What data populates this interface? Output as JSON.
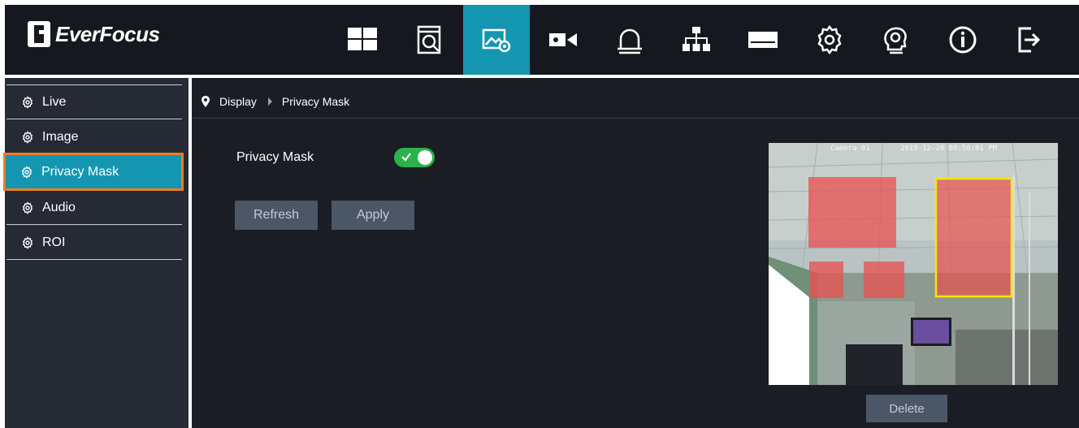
{
  "brand": {
    "name": "EverFocus"
  },
  "nav": [
    {
      "icon": "grid-icon",
      "active": false
    },
    {
      "icon": "playback-icon",
      "active": false
    },
    {
      "icon": "image-settings-icon",
      "active": true
    },
    {
      "icon": "camera-icon",
      "active": false
    },
    {
      "icon": "alarm-icon",
      "active": false
    },
    {
      "icon": "network-icon",
      "active": false
    },
    {
      "icon": "storage-icon",
      "active": false
    },
    {
      "icon": "settings-icon",
      "active": false
    },
    {
      "icon": "maintenance-icon",
      "active": false
    },
    {
      "icon": "info-icon",
      "active": false
    },
    {
      "icon": "logout-icon",
      "active": false
    }
  ],
  "sidebar": {
    "items": [
      {
        "label": "Live",
        "active": false
      },
      {
        "label": "Image",
        "active": false
      },
      {
        "label": "Privacy Mask",
        "active": true
      },
      {
        "label": "Audio",
        "active": false
      },
      {
        "label": "ROI",
        "active": false
      }
    ]
  },
  "breadcrumb": {
    "parent": "Display",
    "current": "Privacy Mask"
  },
  "form": {
    "privacy_mask_label": "Privacy Mask",
    "privacy_mask_enabled": true,
    "refresh_label": "Refresh",
    "apply_label": "Apply",
    "delete_label": "Delete"
  },
  "preview": {
    "camera_name": "Camera 01",
    "timestamp": "2018-12-20 09:50:01 PM"
  },
  "colors": {
    "accent": "#1596b0",
    "highlight_border": "#ee7d1e",
    "toggle_on": "#2bb24c",
    "mask": "#e8504f",
    "selected_mask": "#f5e60a"
  }
}
